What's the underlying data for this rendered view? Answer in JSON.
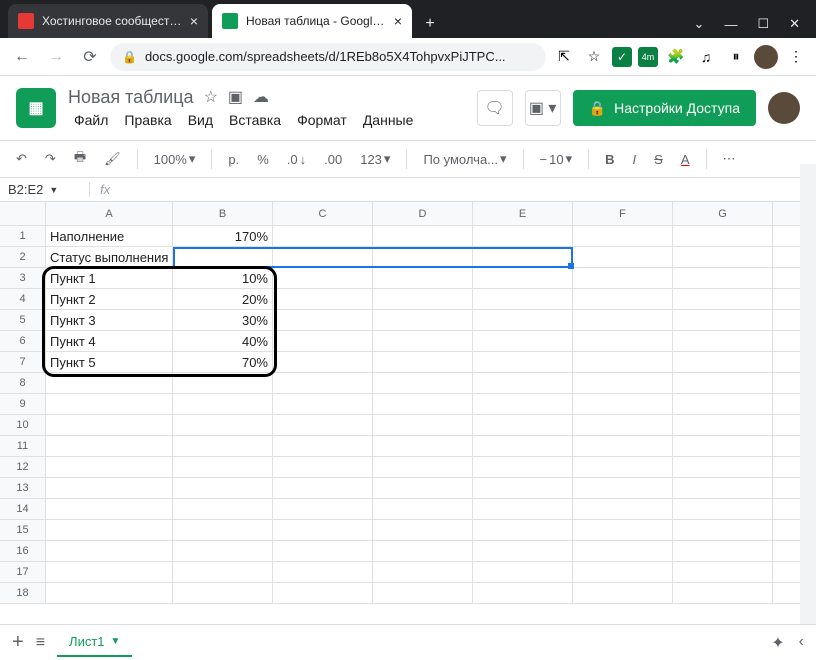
{
  "browser": {
    "tabs": [
      {
        "title": "Хостинговое сообщество «Time..."
      },
      {
        "title": "Новая таблица - Google Табли..."
      }
    ],
    "url": "docs.google.com/spreadsheets/d/1REb8o5X4TohpvxPiJTPC...",
    "ext_badge": "4m"
  },
  "doc": {
    "title": "Новая таблица",
    "menu": [
      "Файл",
      "Правка",
      "Вид",
      "Вставка",
      "Формат",
      "Данные"
    ],
    "share": "Настройки Доступа"
  },
  "toolbar": {
    "zoom": "100%",
    "currency": "р.",
    "percent": "%",
    "dec0": ".0",
    "dec00": ".00",
    "num123": "123",
    "font": "По умолча...",
    "size": "10"
  },
  "cellref": "B2:E2",
  "columns": [
    "A",
    "B",
    "C",
    "D",
    "E",
    "F",
    "G"
  ],
  "rows": [
    {
      "n": 1,
      "A": "Наполнение",
      "B": "170%"
    },
    {
      "n": 2,
      "A": "Статус выполнения",
      "B": ""
    },
    {
      "n": 3,
      "A": "Пункт 1",
      "B": "10%"
    },
    {
      "n": 4,
      "A": "Пункт 2",
      "B": "20%"
    },
    {
      "n": 5,
      "A": "Пункт 3",
      "B": "30%"
    },
    {
      "n": 6,
      "A": "Пункт 4",
      "B": "40%"
    },
    {
      "n": 7,
      "A": "Пункт 5",
      "B": "70%"
    },
    {
      "n": 8
    },
    {
      "n": 9
    },
    {
      "n": 10
    },
    {
      "n": 11
    },
    {
      "n": 12
    },
    {
      "n": 13
    },
    {
      "n": 14
    },
    {
      "n": 15
    },
    {
      "n": 16
    },
    {
      "n": 17
    },
    {
      "n": 18
    }
  ],
  "sheet": {
    "name": "Лист1"
  }
}
